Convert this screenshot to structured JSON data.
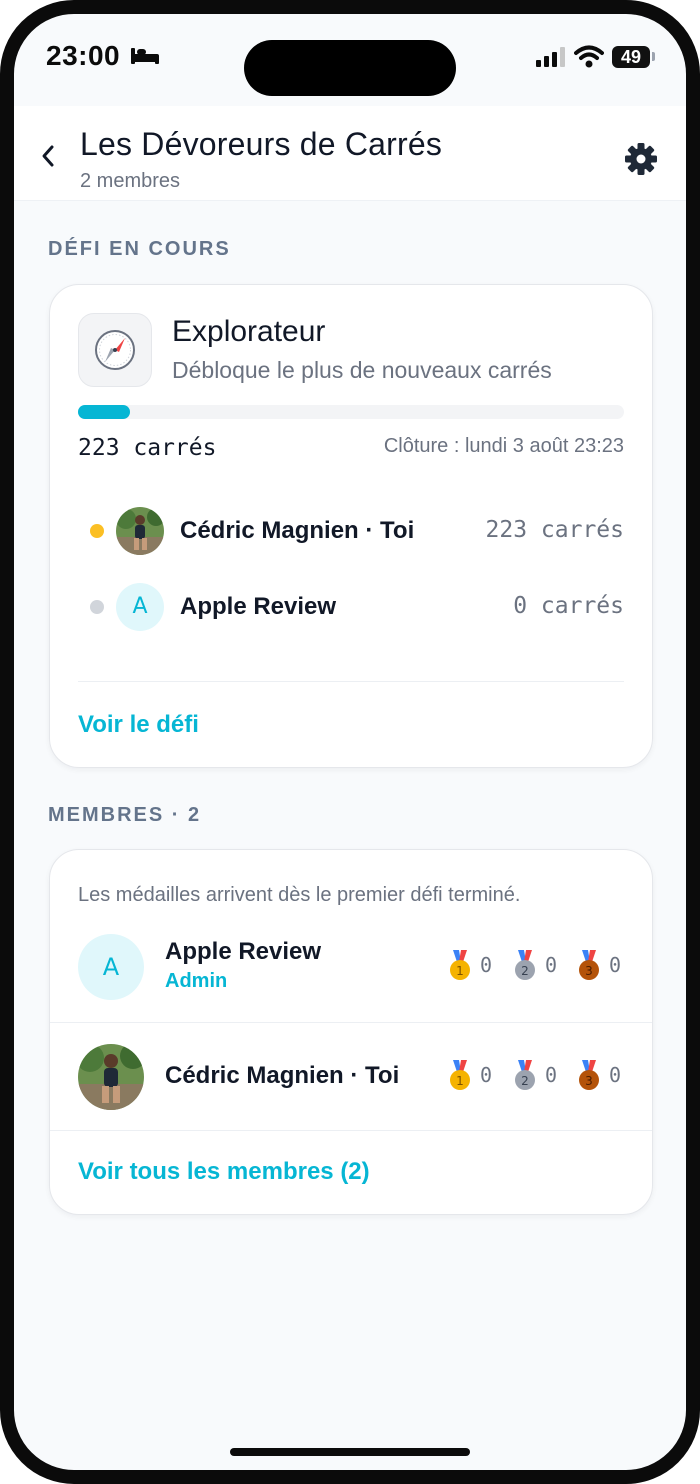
{
  "status_bar": {
    "time": "23:00",
    "battery": "49"
  },
  "header": {
    "title": "Les Dévoreurs de Carrés",
    "subtitle": "2 membres"
  },
  "current_challenge": {
    "section_label": "DÉFI EN COURS",
    "name": "Explorateur",
    "description": "Débloque le plus de nouveaux carrés",
    "progress_fraction": 0.095,
    "total": "223 carrés",
    "deadline": "Clôture : lundi 3 août 23:23",
    "ranking": [
      {
        "name": "Cédric Magnien · Toi",
        "score": "223 carrés",
        "dot_color": "#fbbf24",
        "avatar_type": "photo"
      },
      {
        "name": "Apple Review",
        "score": "0 carrés",
        "dot_color": "#d1d5db",
        "avatar_letter": "A"
      }
    ],
    "link_label": "Voir le défi"
  },
  "members": {
    "section_label": "MEMBRES · 2",
    "note": "Les médailles arrivent dès le premier défi terminé.",
    "list": [
      {
        "name": "Apple Review",
        "role": "Admin",
        "avatar_letter": "A",
        "medals": {
          "gold": "0",
          "silver": "0",
          "bronze": "0"
        }
      },
      {
        "name": "Cédric Magnien · Toi",
        "role": "",
        "avatar_type": "photo",
        "medals": {
          "gold": "0",
          "silver": "0",
          "bronze": "0"
        }
      }
    ],
    "link_label": "Voir tous les membres (2)"
  },
  "colors": {
    "accent": "#06b6d4",
    "gold": "#f5b301",
    "silver": "#9ca3af",
    "bronze": "#b45309"
  }
}
